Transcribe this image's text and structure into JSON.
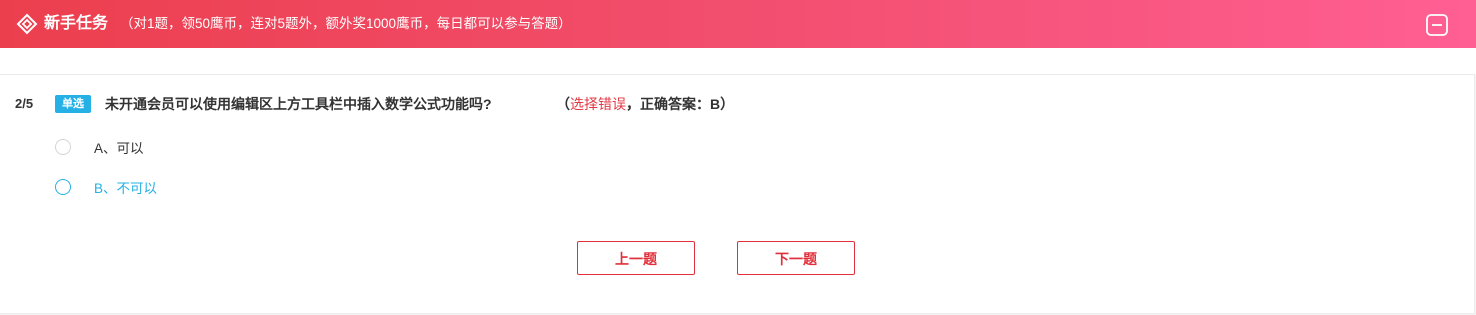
{
  "header": {
    "title": "新手任务",
    "subtitle": "（对1题，领50鹰币，连对5题外，额外奖1000鹰币，每日都可以参与答题）",
    "logo_icon": "diamond-logo-icon",
    "collapse_icon": "collapse-minus-icon"
  },
  "question": {
    "index": "2/5",
    "type_badge": "单选",
    "text": "未开通会员可以使用编辑区上方工具栏中插入数学公式功能吗?",
    "result_open": "（",
    "result_error": "选择错误",
    "result_mid": "，正确答案：",
    "result_answer": "B",
    "result_close": "）",
    "options": [
      {
        "label": "A、可以",
        "selected": false
      },
      {
        "label": "B、不可以",
        "selected": true
      }
    ]
  },
  "buttons": {
    "prev": "上一题",
    "next": "下一题"
  },
  "colors": {
    "header_gradient_start": "#ec3f4e",
    "header_gradient_end": "#ff5f93",
    "accent_blue": "#25b0e6",
    "error_red": "#e23a44",
    "button_red": "#e0303b"
  }
}
